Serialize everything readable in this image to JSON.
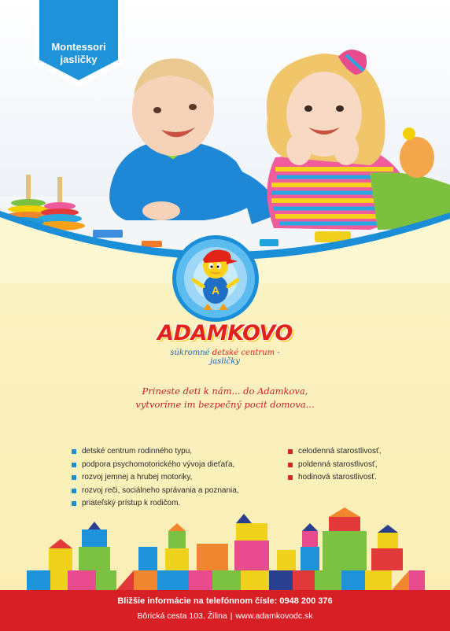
{
  "badge": {
    "line1": "Montessori",
    "line2": "jasličky"
  },
  "logo": {
    "brand": "ADAMKOVO",
    "mascot_letter": "A",
    "tagline_a": "súkromné ",
    "tagline_b": "detské centrum",
    "tagline_c": " - jasličky"
  },
  "slogan": {
    "line1": "Prineste deti k nám... do Adamkova,",
    "line2": "vytvoríme im bezpečný pocit domova..."
  },
  "services_left": [
    "detské centrum rodinného typu,",
    "podpora psychomotorického vývoja dieťaťa,",
    "rozvoj jemnej a hrubej motoriky,",
    "rozvoj reči, sociálneho správania a poznania,",
    "priateľský prístup k rodičom."
  ],
  "services_right": [
    "celodenná starostlivosť,",
    "poldenná starostlivosť,",
    "hodinová starostlivosť."
  ],
  "footer": {
    "line1": "Bližšie informácie na telefónnom čísle: 0948 200 376",
    "address": "Bôrická cesta 103, Žilina",
    "separator": "|",
    "website": "www.adamkovodc.sk"
  },
  "colors": {
    "accent_blue": "#1a8fd8",
    "accent_red": "#d91f26",
    "background": "#fbf1bf"
  }
}
